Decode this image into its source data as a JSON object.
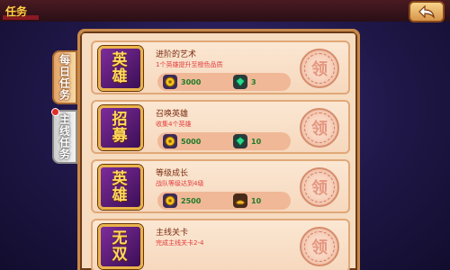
{
  "header": {
    "title": "任务"
  },
  "tabs": [
    {
      "label": "每日任务",
      "active": true
    },
    {
      "label": "主线任务",
      "active": false,
      "has_notice": true
    }
  ],
  "tasks": [
    {
      "icon_text": "英雄",
      "name": "进阶的艺术",
      "desc": "1个英雄提升至橙色品质",
      "rewards": [
        {
          "icon": "coin-icon",
          "amount": "3000"
        },
        {
          "icon": "gem-icon",
          "amount": "3"
        }
      ],
      "claim_label": "领"
    },
    {
      "icon_text": "招募",
      "name": "召唤英雄",
      "desc": "收集4个英雄",
      "rewards": [
        {
          "icon": "coin-icon",
          "amount": "5000"
        },
        {
          "icon": "gem-icon",
          "amount": "10"
        }
      ],
      "claim_label": "领"
    },
    {
      "icon_text": "英雄",
      "name": "等级成长",
      "desc": "战队等级达到4级",
      "rewards": [
        {
          "icon": "coin-icon",
          "amount": "2500"
        },
        {
          "icon": "gold-ingot-icon",
          "amount": "10"
        }
      ],
      "claim_label": "领"
    },
    {
      "icon_text": "无双",
      "name": "主线关卡",
      "desc": "完成主线关卡2-4",
      "rewards": [],
      "claim_label": "领"
    }
  ],
  "colors": {
    "title": "#ffd24a",
    "reward_amount": "#1f7a2a",
    "task_desc": "#e23b3b"
  }
}
